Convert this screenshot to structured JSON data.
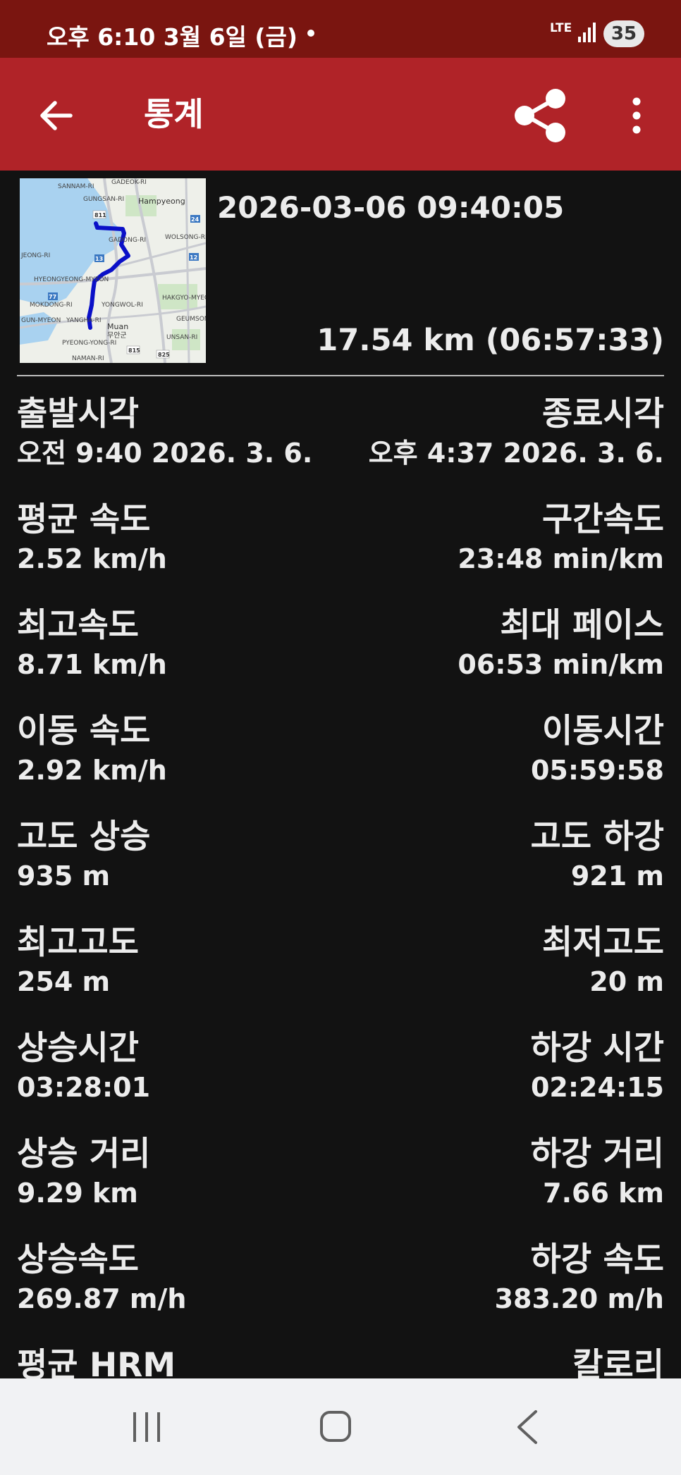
{
  "status_bar": {
    "time_date": "오후 6:10  3월 6일 (금)",
    "network": "LTE",
    "battery": "35"
  },
  "app_bar": {
    "title": "통계",
    "icons": [
      "back-arrow-icon",
      "share-icon",
      "more-vert-icon"
    ]
  },
  "track": {
    "datetime": "2026-03-06 09:40:05",
    "summary": "17.54 km (06:57:33)"
  },
  "map": {
    "labels": {
      "gadeok": "GADEOK-RI",
      "sannam": "SANNAM-RI",
      "gungsan": "GUNGSAN-RI",
      "hampyeong": "Hampyeong",
      "gadong": "GADONG-RI",
      "wolsong": "WOLSONG-RI",
      "jeong": "JEONG-RI",
      "hyeongyeong": "HYEONGYEONG-MYEON",
      "hakgyo": "HAKGYO-MYEON",
      "mokdong": "MOKDONG-RI",
      "yongwol": "YONGWOL-RI",
      "geumson": "GEUMSON",
      "gunmyeon": "GUN-MYEON",
      "yangha": "YANGHA-RI",
      "muan": "Muan",
      "muan_ko": "무안군",
      "unsan": "UNSAN-RI",
      "pyeongyong": "PYEONG-YONG-RI",
      "naman": "NAMAN-RI"
    },
    "road_numbers": [
      "811",
      "24",
      "13",
      "12",
      "77",
      "815",
      "825"
    ],
    "colors": {
      "land": "#eef0ea",
      "water": "#a9d2f0",
      "park": "#cfe6c6",
      "route": "#0a10c8"
    }
  },
  "stats": [
    {
      "left_label": "출발시각",
      "left_value": "오전 9:40 2026. 3. 6.",
      "right_label": "종료시각",
      "right_value": "오후 4:37 2026. 3. 6."
    },
    {
      "left_label": "평균 속도",
      "left_value": "2.52 km/h",
      "right_label": "구간속도",
      "right_value": "23:48 min/km"
    },
    {
      "left_label": "최고속도",
      "left_value": "8.71 km/h",
      "right_label": "최대 페이스",
      "right_value": "06:53 min/km"
    },
    {
      "left_label": "이동 속도",
      "left_value": "2.92 km/h",
      "right_label": "이동시간",
      "right_value": "05:59:58"
    },
    {
      "left_label": "고도 상승",
      "left_value": "935 m",
      "right_label": "고도 하강",
      "right_value": "921 m"
    },
    {
      "left_label": "최고고도",
      "left_value": "254 m",
      "right_label": "최저고도",
      "right_value": "20 m"
    },
    {
      "left_label": "상승시간",
      "left_value": "03:28:01",
      "right_label": "하강 시간",
      "right_value": "02:24:15"
    },
    {
      "left_label": "상승 거리",
      "left_value": "9.29 km",
      "right_label": "하강 거리",
      "right_value": "7.66 km"
    },
    {
      "left_label": "상승속도",
      "left_value": "269.87 m/h",
      "right_label": "하강 속도",
      "right_value": "383.20 m/h"
    },
    {
      "left_label": "평균 HRM",
      "left_value": "",
      "right_label": "칼로리",
      "right_value": ""
    }
  ],
  "nav_bar": {
    "icons": [
      "recent-apps-icon",
      "home-icon",
      "back-icon"
    ]
  },
  "colors": {
    "status_bar": "#7a1510",
    "app_bar": "#b02328",
    "background": "#121212",
    "text": "#ececec",
    "nav_bar": "#f1f2f4"
  }
}
